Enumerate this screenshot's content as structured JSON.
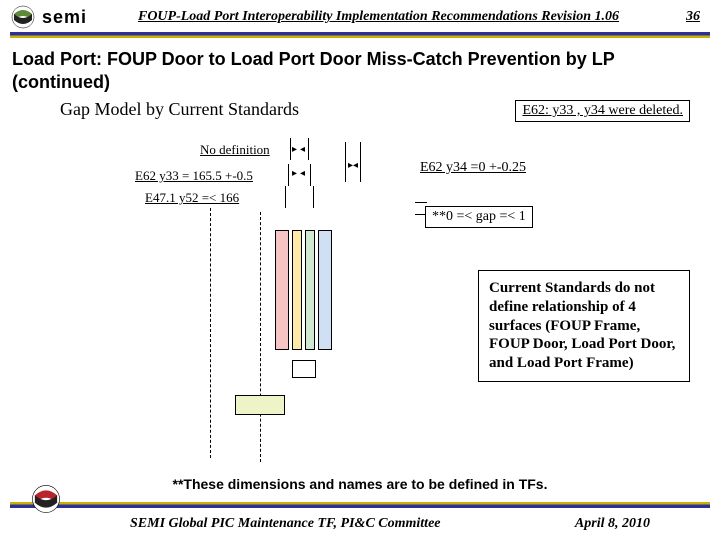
{
  "header": {
    "brand": "semi",
    "doc_title": "FOUP-Load Port Interoperability Implementation Recommendations Revision 1.06",
    "page_number": "36"
  },
  "title": "Load Port: FOUP Door to Load Port Door Miss-Catch Prevention by LP (continued)",
  "subtitle": "Gap Model by Current Standards",
  "deleted_note": "E62: y33 , y34 were deleted.",
  "labels": {
    "no_def": "No definition",
    "e62y33": "E62 y33 = 165.5 +-0.5",
    "e47": "E47.1 y52 =< 166",
    "e62y34": "E62 y34 =0 +-0.25",
    "gap": "**0 =< gap =< 1"
  },
  "callout": "Current Standards do not define relationship of 4 surfaces (FOUP Frame, FOUP Door, Load Port Door, and Load Port Frame)",
  "footnote": "**These dimensions and names are to be defined in TFs.",
  "footer": {
    "left": "SEMI Global PIC Maintenance TF, PI&C Committee",
    "right": "April 8, 2010"
  }
}
